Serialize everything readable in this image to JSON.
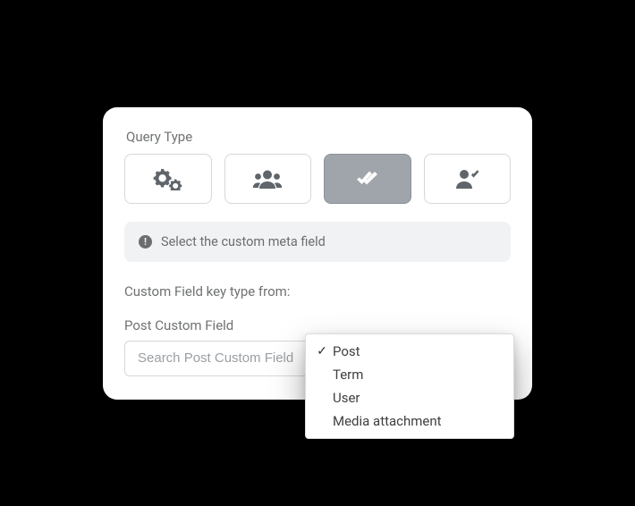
{
  "header": {
    "query_type_label": "Query Type"
  },
  "types": {
    "settings": "settings",
    "users": "users",
    "meta": "meta",
    "user_role": "user role"
  },
  "notice": {
    "text": "Select the custom meta field"
  },
  "fields": {
    "key_type_label": "Custom Field key type from:",
    "post_custom_label": "Post Custom Field",
    "search_placeholder": "Search Post Custom Field"
  },
  "dropdown": {
    "options": [
      {
        "label": "Post",
        "selected": true
      },
      {
        "label": "Term",
        "selected": false
      },
      {
        "label": "User",
        "selected": false
      },
      {
        "label": "Media attachment",
        "selected": false
      }
    ]
  }
}
